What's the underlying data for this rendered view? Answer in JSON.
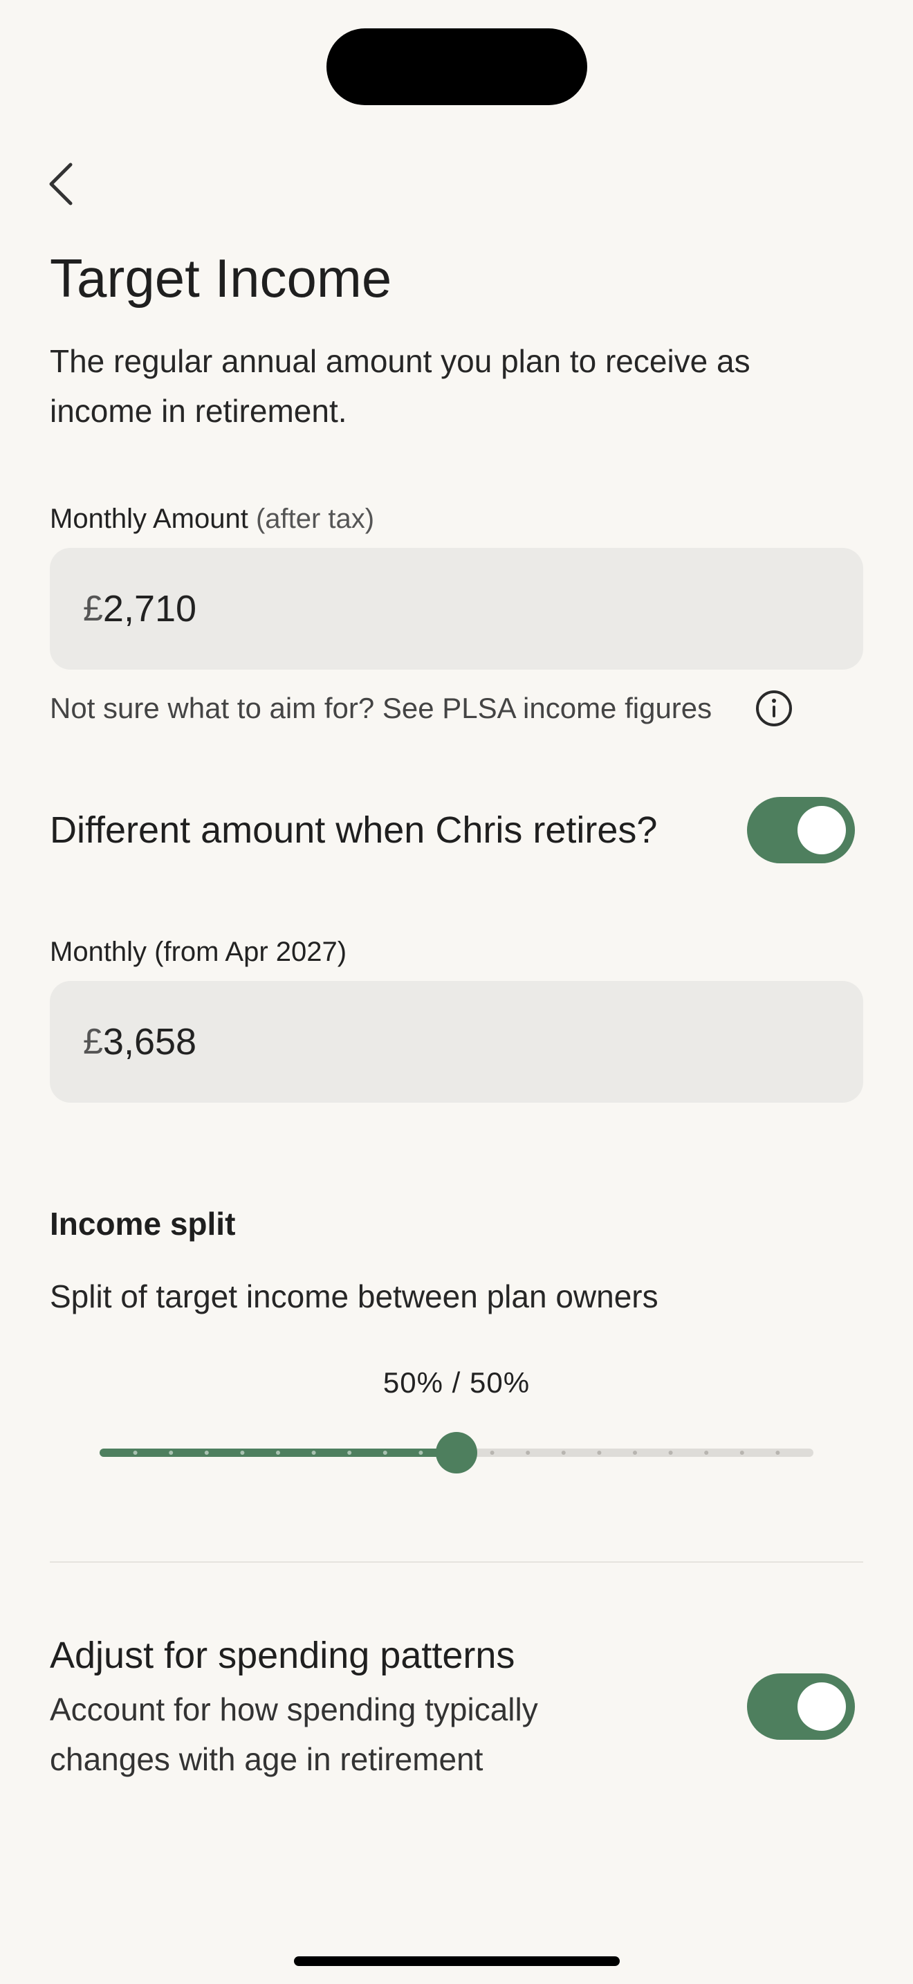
{
  "header": {
    "title": "Target Income",
    "description": "The regular annual amount you plan to receive as income in retirement."
  },
  "monthly_amount": {
    "label": "Monthly Amount",
    "label_note": "(after tax)",
    "currency": "£",
    "value": "2,710",
    "hint": "Not sure what to aim for? See PLSA income figures"
  },
  "different_amount": {
    "label": "Different amount when Chris retires?",
    "enabled": true
  },
  "monthly_from": {
    "label": "Monthly (from Apr 2027)",
    "currency": "£",
    "value": "3,658"
  },
  "income_split": {
    "heading": "Income split",
    "subtext": "Split of target income between plan owners",
    "value_label": "50% / 50%",
    "value_fraction": 0.5,
    "steps": 20
  },
  "spending_patterns": {
    "title": "Adjust for spending patterns",
    "description": "Account for how spending typically changes with age in retirement",
    "enabled": true
  },
  "colors": {
    "accent": "#4e7f5e",
    "background": "#f9f7f3",
    "field": "#ebeae7"
  },
  "icons": {
    "back": "chevron-left-icon",
    "info": "info-circle-icon"
  }
}
